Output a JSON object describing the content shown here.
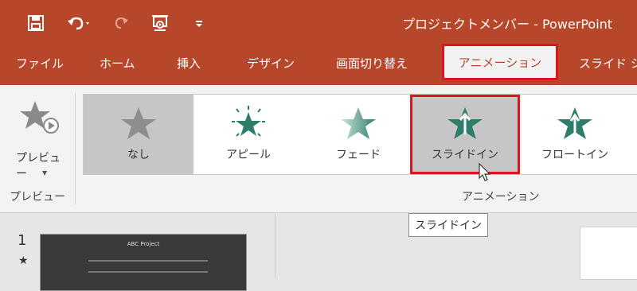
{
  "window": {
    "title": "プロジェクトメンバー - PowerPoint"
  },
  "quick_access": {
    "save_icon": "save-icon",
    "undo_icon": "undo-icon",
    "redo_icon": "redo-icon",
    "present_icon": "present-from-start-icon",
    "customize_icon": "customize-qat-icon"
  },
  "tabs": [
    {
      "label": "ファイル"
    },
    {
      "label": "ホーム"
    },
    {
      "label": "挿入"
    },
    {
      "label": "デザイン"
    },
    {
      "label": "画面切り替え"
    },
    {
      "label": "アニメーション"
    },
    {
      "label": "スライド シ"
    }
  ],
  "ribbon": {
    "preview": {
      "button_label": "プレビュー",
      "group_label": "プレビュー"
    },
    "animation_group_label": "アニメーション",
    "gallery": [
      {
        "label": "なし",
        "icon": "star-gray-icon"
      },
      {
        "label": "アピール",
        "icon": "appear-star-icon"
      },
      {
        "label": "フェード",
        "icon": "fade-star-icon"
      },
      {
        "label": "スライドイン",
        "icon": "fly-in-star-icon"
      },
      {
        "label": "フロートイン",
        "icon": "float-in-star-icon"
      }
    ]
  },
  "tooltip": {
    "text": "スライドイン"
  },
  "slides_pane": {
    "slide_number": "1",
    "animation_marker": "★",
    "thumb_title": "ABC Project"
  },
  "colors": {
    "accent": "#b7472a",
    "highlight": "#e0141e",
    "star_green": "#2e7d6b"
  }
}
